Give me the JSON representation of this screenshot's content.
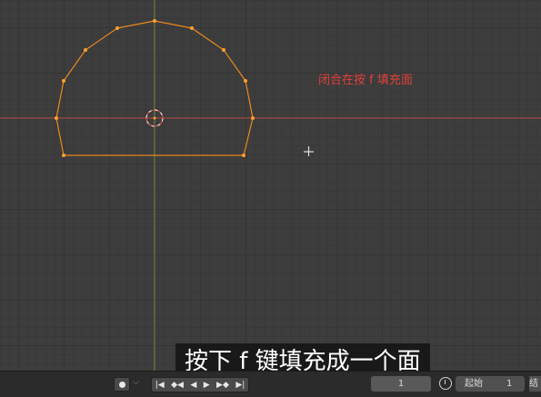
{
  "viewport": {
    "annotation": "闭合在按 f 填充面",
    "colors": {
      "background": "#3d3d3d",
      "x_axis": "#c04a4a",
      "y_axis": "#6b8e3a",
      "edge": "#e8891f",
      "vertex": "#ff9f2e",
      "annotation": "#e0403a"
    }
  },
  "subtitle": "按下 f 键填充成一个面",
  "timeline": {
    "record_icon": "record-dot-icon",
    "transport_icons": [
      "jump-start-icon",
      "prev-keyframe-icon",
      "play-reverse-icon",
      "play-icon",
      "next-keyframe-icon",
      "jump-end-icon"
    ],
    "current_frame": "1",
    "start_label": "起始",
    "start_value": "1",
    "end_label_partial": "结"
  }
}
